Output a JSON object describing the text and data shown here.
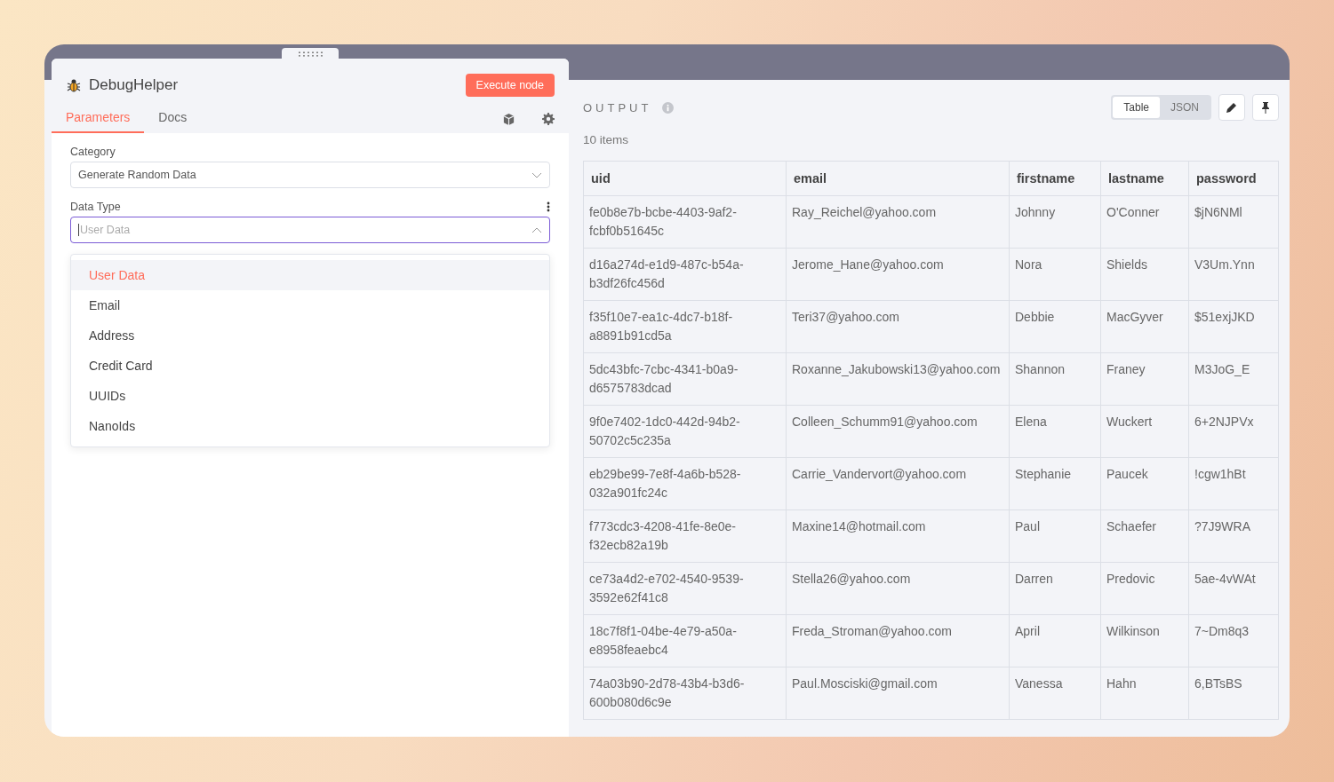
{
  "node": {
    "title": "DebugHelper",
    "execute_button": "Execute node"
  },
  "tabs": [
    {
      "label": "Parameters",
      "selected": true
    },
    {
      "label": "Docs",
      "selected": false
    }
  ],
  "fields": [
    {
      "label": "Category",
      "value": "Generate Random Data",
      "open": false,
      "has_options_menu": false
    },
    {
      "label": "Data Type",
      "placeholder": "User Data",
      "open": true,
      "has_options_menu": true
    }
  ],
  "dropdown": [
    {
      "label": "User Data",
      "selected": true
    },
    {
      "label": "Email",
      "selected": false
    },
    {
      "label": "Address",
      "selected": false
    },
    {
      "label": "Credit Card",
      "selected": false
    },
    {
      "label": "UUIDs",
      "selected": false
    },
    {
      "label": "NanoIds",
      "selected": false
    }
  ],
  "output": {
    "title": "OUTPUT",
    "count": "10 items",
    "views": [
      {
        "label": "Table",
        "selected": true
      },
      {
        "label": "JSON",
        "selected": false
      }
    ]
  },
  "table": {
    "columns": [
      "uid",
      "email",
      "firstname",
      "lastname",
      "password"
    ],
    "rows": [
      [
        "fe0b8e7b-bcbe-4403-9af2-fcbf0b51645c",
        "Ray_Reichel@yahoo.com",
        "Johnny",
        "O'Conner",
        "$jN6NMl"
      ],
      [
        "d16a274d-e1d9-487c-b54a-b3df26fc456d",
        "Jerome_Hane@yahoo.com",
        "Nora",
        "Shields",
        "V3Um.Ynn"
      ],
      [
        "f35f10e7-ea1c-4dc7-b18f-a8891b91cd5a",
        "Teri37@yahoo.com",
        "Debbie",
        "MacGyver",
        "$51exjJKD"
      ],
      [
        "5dc43bfc-7cbc-4341-b0a9-d6575783dcad",
        "Roxanne_Jakubowski13@yahoo.com",
        "Shannon",
        "Franey",
        "M3JoG_E"
      ],
      [
        "9f0e7402-1dc0-442d-94b2-50702c5c235a",
        "Colleen_Schumm91@yahoo.com",
        "Elena",
        "Wuckert",
        "6+2NJPVx"
      ],
      [
        "eb29be99-7e8f-4a6b-b528-032a901fc24c",
        "Carrie_Vandervort@yahoo.com",
        "Stephanie",
        "Paucek",
        "!cgw1hBt"
      ],
      [
        "f773cdc3-4208-41fe-8e0e-f32ecb82a19b",
        "Maxine14@hotmail.com",
        "Paul",
        "Schaefer",
        "?7J9WRA"
      ],
      [
        "ce73a4d2-e702-4540-9539-3592e62f41c8",
        "Stella26@yahoo.com",
        "Darren",
        "Predovic",
        "5ae-4vWAt"
      ],
      [
        "18c7f8f1-04be-4e79-a50a-e8958feaebc4",
        "Freda_Stroman@yahoo.com",
        "April",
        "Wilkinson",
        "7~Dm8q3"
      ],
      [
        "74a03b90-2d78-43b4-b3d6-600b080d6c9e",
        "Paul.Mosciski@gmail.com",
        "Vanessa",
        "Hahn",
        "6,BTsBS"
      ]
    ]
  }
}
